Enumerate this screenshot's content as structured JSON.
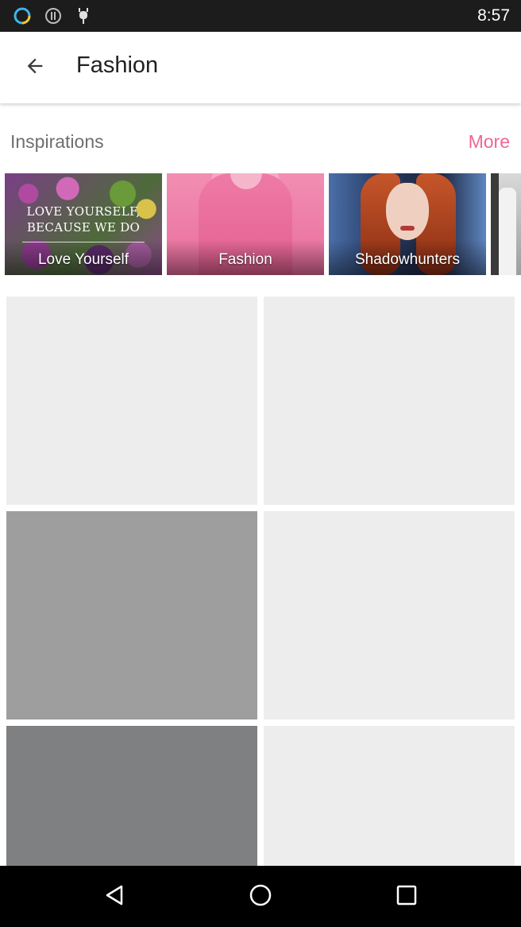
{
  "status_bar": {
    "time": "8:57",
    "icons": [
      "circle-ring-icon",
      "info-circle-icon",
      "android-debug-icon"
    ]
  },
  "app_bar": {
    "back_icon": "arrow-left-icon",
    "title": "Fashion"
  },
  "inspirations": {
    "title": "Inspirations",
    "more_label": "More",
    "accent_color": "#f06595",
    "cards": [
      {
        "label": "Love Yourself",
        "quote_line1": "LOVE YOURSELF,",
        "quote_line2": "BECAUSE WE DO"
      },
      {
        "label": "Fashion"
      },
      {
        "label": "Shadowhunters"
      },
      {
        "label": ""
      }
    ]
  },
  "grid": {
    "tile_colors": [
      "#ededed",
      "#ededed",
      "#9e9e9e",
      "#ededed",
      "#7f8082",
      "#ededed"
    ]
  },
  "nav_bar": {
    "buttons": [
      "back-triangle-icon",
      "home-circle-icon",
      "recents-square-icon"
    ]
  }
}
